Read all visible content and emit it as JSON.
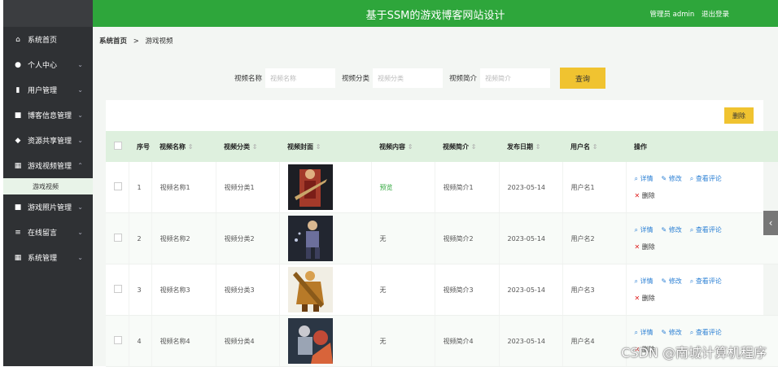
{
  "header": {
    "title": "基于SSM的游戏博客网站设计",
    "user_label": "管理员 admin",
    "logout_label": "退出登录"
  },
  "sidebar": {
    "items": [
      {
        "icon": "home-icon",
        "glyph": "⌂",
        "label": "系统首页",
        "chev": ""
      },
      {
        "icon": "person-icon",
        "glyph": "●",
        "label": "个人中心",
        "chev": "⌄"
      },
      {
        "icon": "bar-chart-icon",
        "glyph": "▮",
        "label": "用户管理",
        "chev": "⌄"
      },
      {
        "icon": "doc-icon",
        "glyph": "■",
        "label": "博客信息管理",
        "chev": "⌄"
      },
      {
        "icon": "share-icon",
        "glyph": "◆",
        "label": "资源共享管理",
        "chev": "⌄"
      },
      {
        "icon": "grid-icon",
        "glyph": "▦",
        "label": "游戏视频管理",
        "chev": "⌃"
      }
    ],
    "sub_item": "游戏视频",
    "items2": [
      {
        "icon": "doc-icon",
        "glyph": "■",
        "label": "游戏照片管理",
        "chev": "⌄"
      },
      {
        "icon": "list-icon",
        "glyph": "≡",
        "label": "在线留言",
        "chev": "⌄"
      },
      {
        "icon": "grid-icon",
        "glyph": "▦",
        "label": "系统管理",
        "chev": "⌄"
      }
    ]
  },
  "breadcrumb": {
    "home": "系统首页",
    "sep": ">",
    "current": "游戏视频"
  },
  "search": {
    "name_label": "视频名称",
    "name_placeholder": "视频名称",
    "cat_label": "视频分类",
    "cat_placeholder": "视频分类",
    "intro_label": "视频简介",
    "intro_placeholder": "视频简介",
    "button": "查询"
  },
  "toolbar": {
    "delete": "删除"
  },
  "table": {
    "headers": [
      "序号",
      "视频名称",
      "视频分类",
      "视频封面",
      "视频内容",
      "视频简介",
      "发布日期",
      "用户名",
      "操作"
    ],
    "rows": [
      {
        "no": "1",
        "name": "视频名称1",
        "cat": "视频分类1",
        "content": "预览",
        "intro": "视频简介1",
        "date": "2023-05-14",
        "user": "用户名1"
      },
      {
        "no": "2",
        "name": "视频名称2",
        "cat": "视频分类2",
        "content": "无",
        "intro": "视频简介2",
        "date": "2023-05-14",
        "user": "用户名2"
      },
      {
        "no": "3",
        "name": "视频名称3",
        "cat": "视频分类3",
        "content": "无",
        "intro": "视频简介3",
        "date": "2023-05-14",
        "user": "用户名3"
      },
      {
        "no": "4",
        "name": "视频名称4",
        "cat": "视频分类4",
        "content": "无",
        "intro": "视频简介4",
        "date": "2023-05-14",
        "user": "用户名4"
      }
    ],
    "ops": {
      "detail": "详情",
      "edit": "修改",
      "comments": "查看评论",
      "delete": "删除"
    }
  },
  "watermark": "CSDN @南城计算机程序",
  "colors": {
    "accent": "#2ea63b",
    "button": "#f0c330",
    "sidebar": "#2f3134",
    "link": "#2a7fd4"
  }
}
